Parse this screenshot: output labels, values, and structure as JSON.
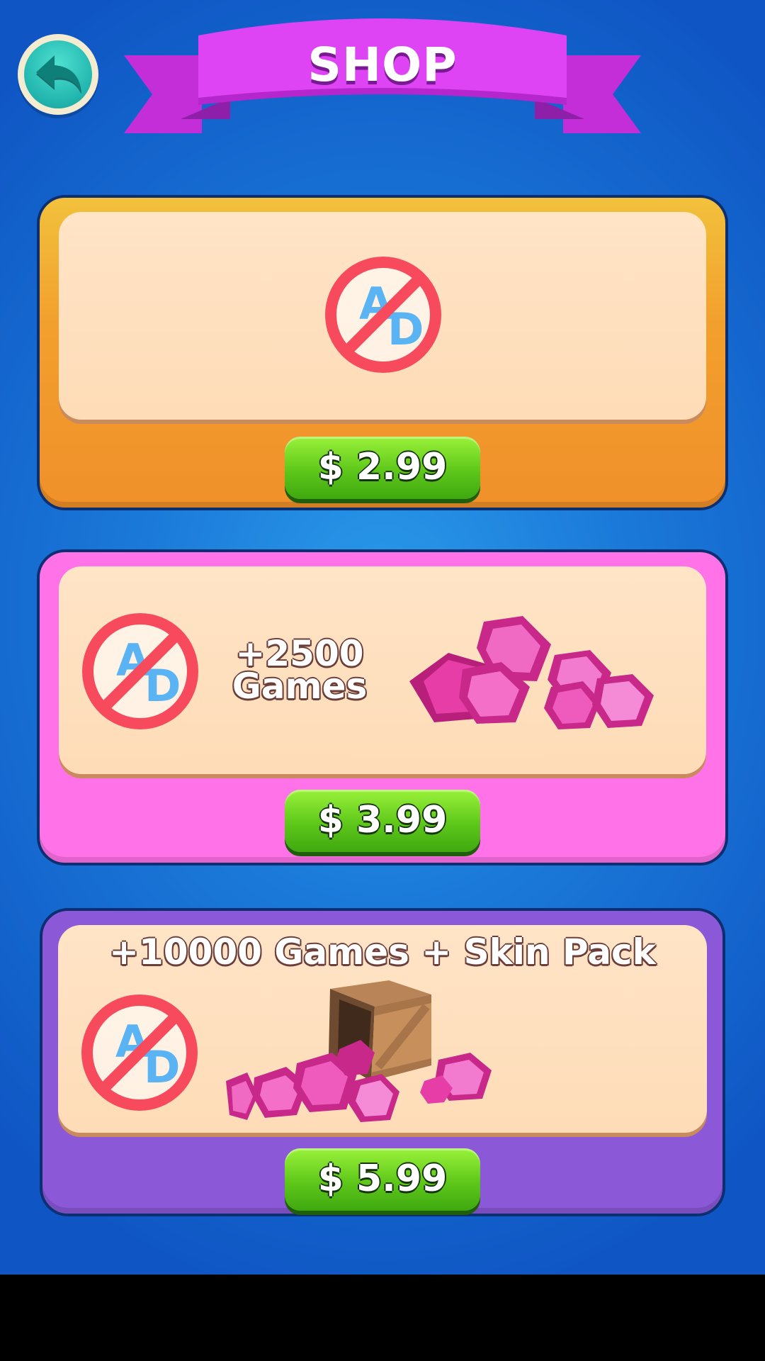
{
  "header": {
    "title": "SHOP",
    "back_icon": "back-arrow-icon",
    "colors": {
      "banner": "#d93ef0",
      "back_button": "#20b4ad"
    }
  },
  "offers": [
    {
      "id": "no-ads",
      "text": "",
      "icon": "no-ads-icon",
      "price": "$ 2.99",
      "color": "#f2a02d"
    },
    {
      "id": "no-ads-games",
      "text_line1": "+2500",
      "text_line2": "Games",
      "icon": "no-ads-icon",
      "image": "gems-pile-icon",
      "price": "$ 3.99",
      "color": "#ff72e8"
    },
    {
      "id": "no-ads-games-skins",
      "text": "+10000 Games + Skin Pack",
      "icon": "no-ads-icon",
      "image": "crate-with-gems-icon",
      "price": "$ 5.99",
      "color": "#8b58d8"
    }
  ],
  "colors": {
    "background": "#1a78d8",
    "button": "#5ec71a",
    "panel": "#ffe4c6"
  }
}
